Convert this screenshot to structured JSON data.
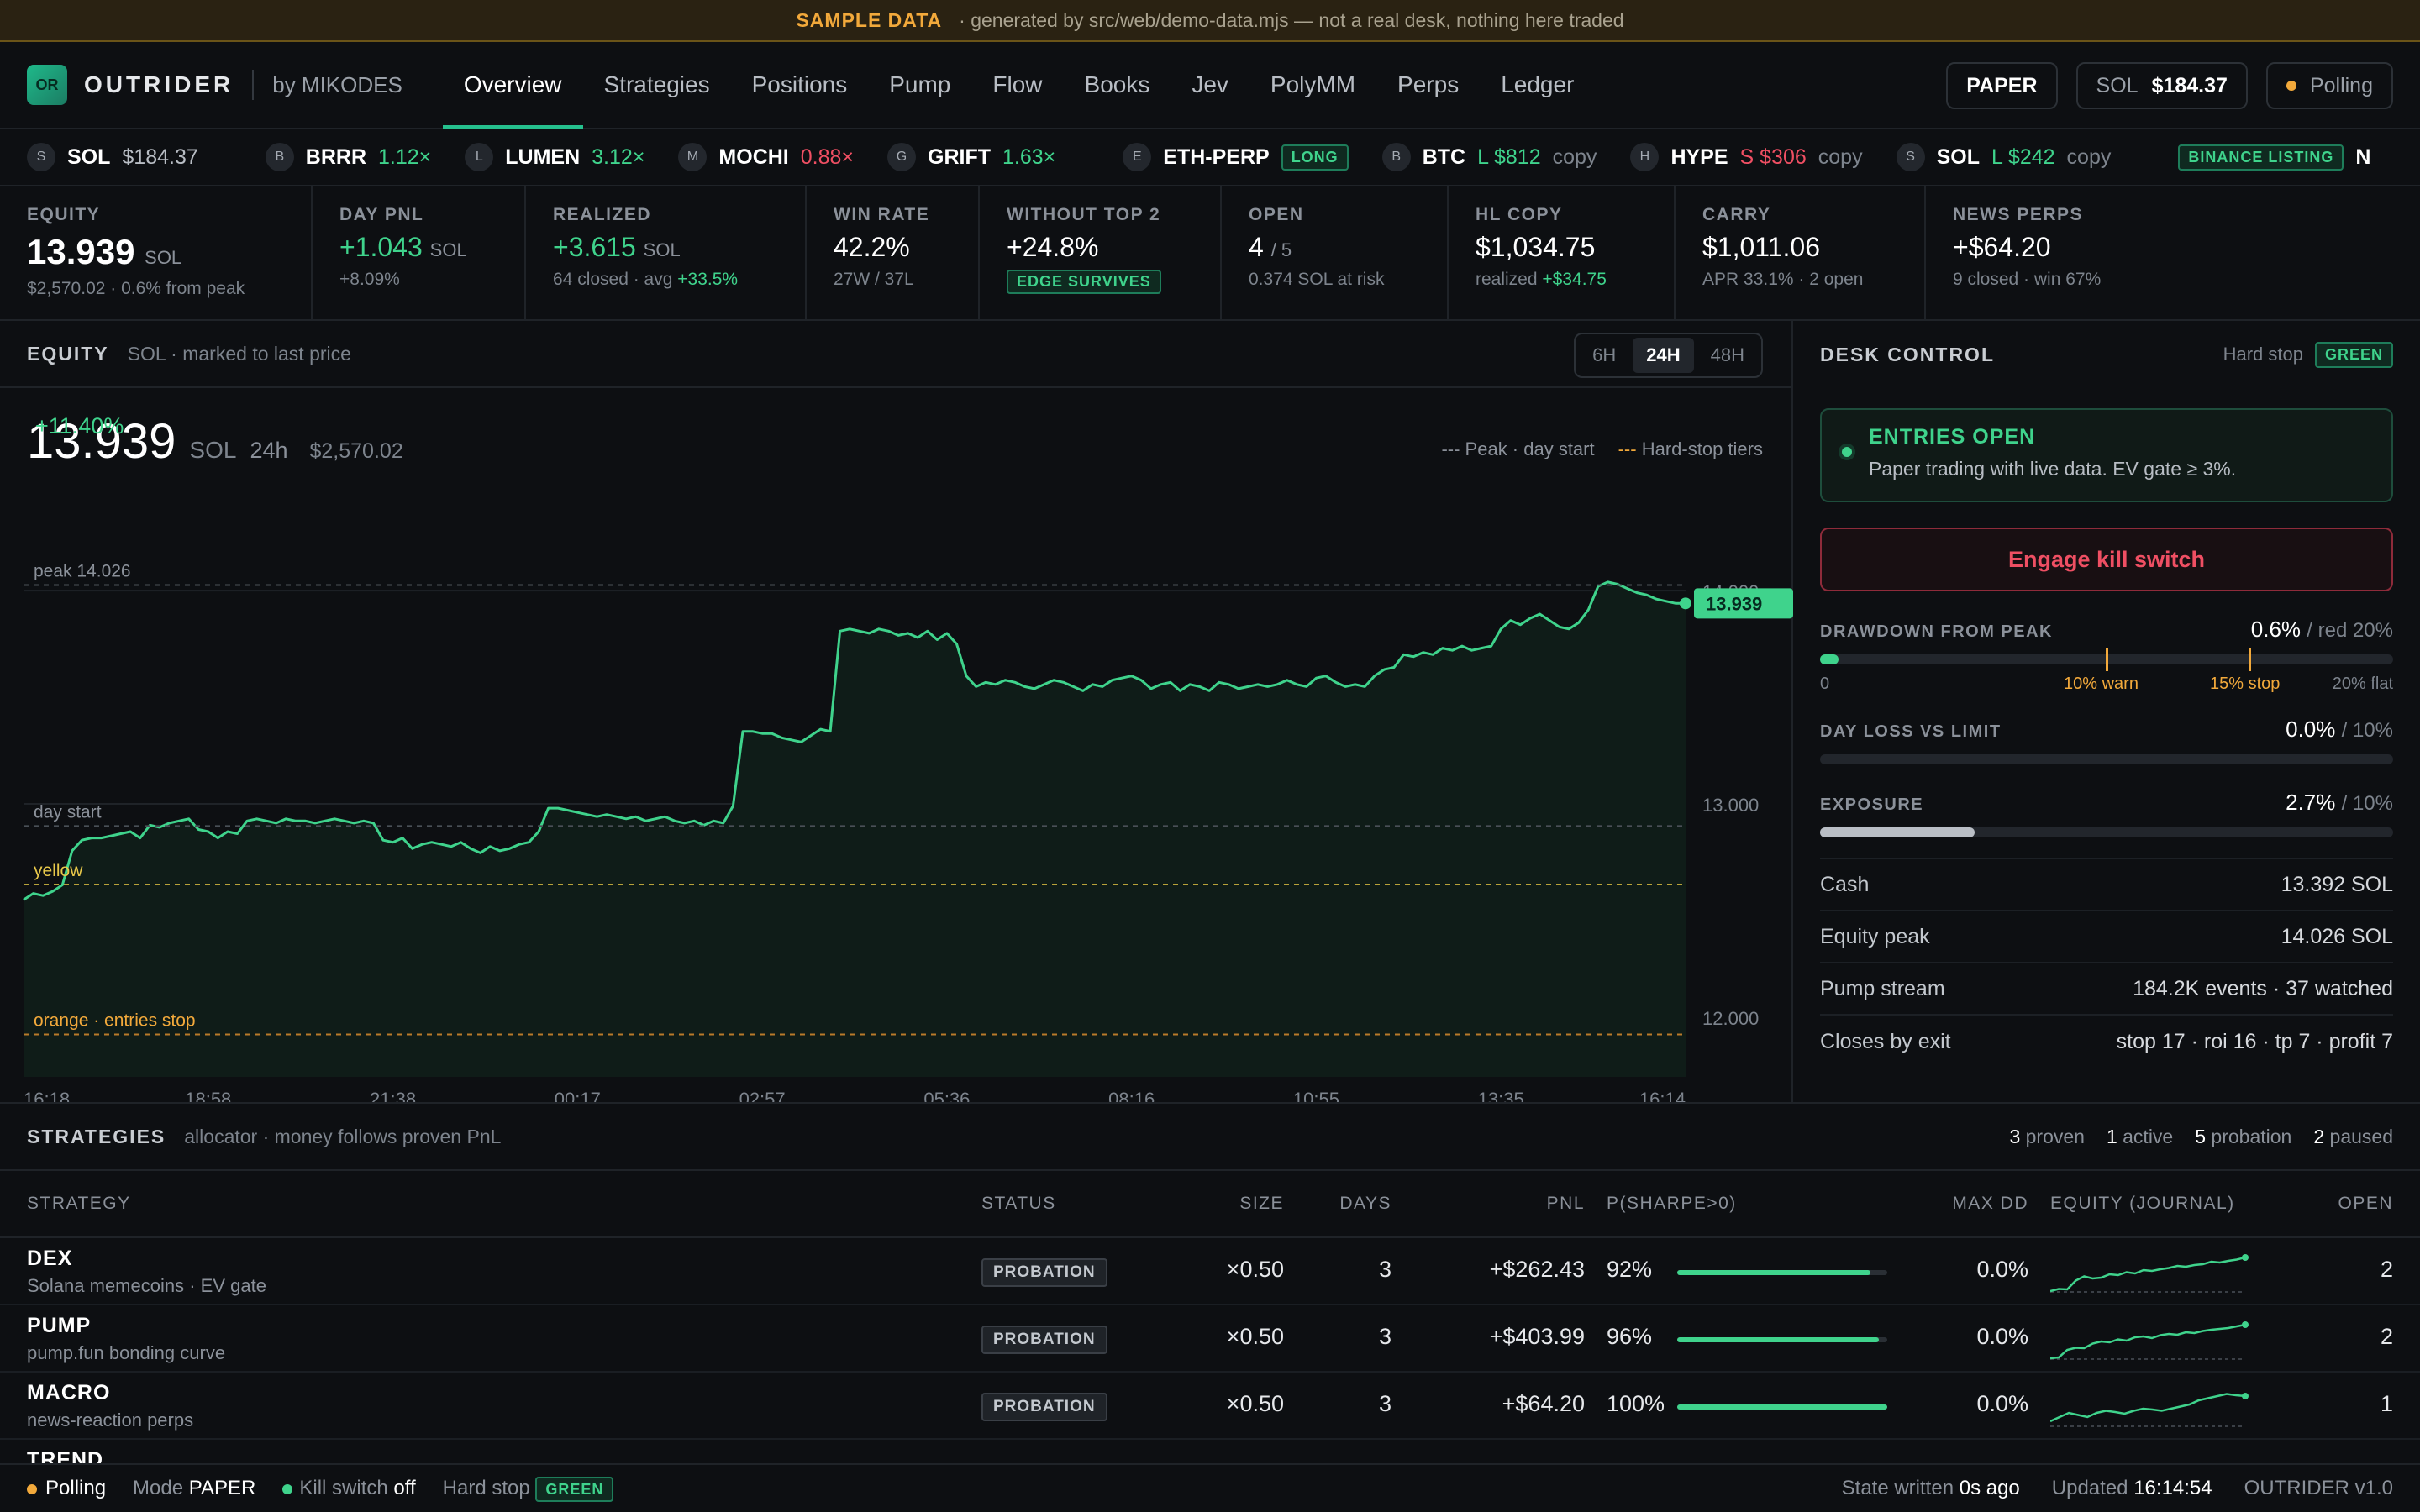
{
  "banner": {
    "title": "SAMPLE DATA",
    "text": "· generated by src/web/demo-data.mjs — not a real desk, nothing here traded"
  },
  "header": {
    "logo": "OR",
    "brand": "OUTRIDER",
    "byline": "by MIKODES",
    "nav": [
      "Overview",
      "Strategies",
      "Positions",
      "Pump",
      "Flow",
      "Books",
      "Jev",
      "PolyMM",
      "Perps",
      "Ledger"
    ],
    "mode": "PAPER",
    "sol_label": "SOL",
    "sol_price": "$184.37",
    "polling": "Polling"
  },
  "ticker": [
    {
      "av": "S",
      "sym": "SOL",
      "val": "$184.37",
      "tone": "dim"
    },
    {
      "av": "B",
      "sym": "BRRR",
      "val": "1.12×",
      "tone": "up"
    },
    {
      "av": "L",
      "sym": "LUMEN",
      "val": "3.12×",
      "tone": "up"
    },
    {
      "av": "M",
      "sym": "MOCHI",
      "val": "0.88×",
      "tone": "dn"
    },
    {
      "av": "G",
      "sym": "GRIFT",
      "val": "1.63×",
      "tone": "up"
    },
    {
      "av": "E",
      "sym": "ETH-PERP",
      "tag": "LONG"
    },
    {
      "av": "B",
      "sym": "BTC",
      "val": "L $812",
      "tone": "up",
      "extra": "copy"
    },
    {
      "av": "H",
      "sym": "HYPE",
      "val": "S $306",
      "tone": "dn",
      "extra": "copy"
    },
    {
      "av": "S",
      "sym": "SOL",
      "val": "L $242",
      "tone": "up",
      "extra": "copy"
    },
    {
      "tag": "BINANCE LISTING",
      "sym": "N"
    }
  ],
  "stats": [
    {
      "label": "EQUITY",
      "value": "13.939",
      "unit": "SOL",
      "note": "$2,570.02 · 0.6% from peak"
    },
    {
      "label": "DAY PNL",
      "value": "+1.043",
      "unit": "SOL",
      "note": "+8.09%"
    },
    {
      "label": "REALIZED",
      "value": "+3.615",
      "unit": "SOL",
      "note_a": "64 closed · avg",
      "note_b": "+33.5%"
    },
    {
      "label": "WIN RATE",
      "value": "42.2%",
      "note": "27W / 37L"
    },
    {
      "label": "WITHOUT TOP 2",
      "value": "+24.8%",
      "tag": "EDGE SURVIVES"
    },
    {
      "label": "OPEN",
      "value": "4",
      "unit": "/ 5",
      "note": "0.374 SOL at risk"
    },
    {
      "label": "HL COPY",
      "value": "$1,034.75",
      "note_a": "realized",
      "note_b": "+$34.75"
    },
    {
      "label": "CARRY",
      "value": "$1,011.06",
      "note": "APR 33.1% · 2 open"
    },
    {
      "label": "NEWS PERPS",
      "value": "+$64.20",
      "note": "9 closed · win 67%"
    }
  ],
  "equity_panel": {
    "title": "EQUITY",
    "subtitle": "SOL · marked to last price",
    "ranges": [
      "6H",
      "24H",
      "48H"
    ],
    "active_range": "24H",
    "value": "13.939",
    "unit": "SOL",
    "change": "+11.40%",
    "window": "24h",
    "usd": "$2,570.02",
    "legend_peak": "--- Peak · day start",
    "legend_stop": "--- Hard-stop tiers"
  },
  "chart_data": {
    "type": "line",
    "ylim": [
      11.72,
      14.28
    ],
    "x_labels": [
      "16:18",
      "18:58",
      "21:38",
      "00:17",
      "02:57",
      "05:36",
      "08:16",
      "10:55",
      "13:35",
      "16:14"
    ],
    "y_ticks": [
      "12.000",
      "13.000",
      "14.000"
    ],
    "y_tick_values": [
      12.0,
      13.0,
      14.0
    ],
    "references": [
      {
        "label": "peak 14.026",
        "value": 14.026,
        "kind": "peak"
      },
      {
        "label": "day start",
        "value": 12.896,
        "kind": "day"
      },
      {
        "label": "yellow",
        "value": 12.622,
        "kind": "yellow"
      },
      {
        "label": "orange · entries stop",
        "value": 11.919,
        "kind": "orange"
      }
    ],
    "last_label": "13.939",
    "values": [
      12.55,
      12.58,
      12.57,
      12.59,
      12.62,
      12.78,
      12.83,
      12.84,
      12.84,
      12.85,
      12.86,
      12.87,
      12.84,
      12.9,
      12.89,
      12.91,
      12.92,
      12.93,
      12.88,
      12.87,
      12.84,
      12.87,
      12.86,
      12.92,
      12.93,
      12.92,
      12.91,
      12.93,
      12.92,
      12.92,
      12.91,
      12.92,
      12.93,
      12.92,
      12.91,
      12.92,
      12.91,
      12.83,
      12.82,
      12.84,
      12.79,
      12.81,
      12.82,
      12.81,
      12.8,
      12.82,
      12.79,
      12.77,
      12.8,
      12.78,
      12.79,
      12.81,
      12.82,
      12.87,
      12.98,
      12.98,
      12.97,
      12.96,
      12.95,
      12.94,
      12.95,
      12.94,
      12.93,
      12.94,
      12.92,
      12.93,
      12.94,
      12.92,
      12.91,
      12.92,
      12.9,
      12.92,
      12.91,
      12.99,
      13.34,
      13.34,
      13.33,
      13.33,
      13.31,
      13.3,
      13.29,
      13.32,
      13.35,
      13.34,
      13.81,
      13.82,
      13.81,
      13.8,
      13.82,
      13.81,
      13.79,
      13.8,
      13.78,
      13.81,
      13.77,
      13.8,
      13.75,
      13.6,
      13.55,
      13.57,
      13.56,
      13.58,
      13.57,
      13.55,
      13.54,
      13.56,
      13.58,
      13.57,
      13.55,
      13.53,
      13.56,
      13.55,
      13.58,
      13.59,
      13.6,
      13.58,
      13.54,
      13.56,
      13.57,
      13.53,
      13.56,
      13.55,
      13.53,
      13.57,
      13.56,
      13.54,
      13.55,
      13.56,
      13.55,
      13.56,
      13.58,
      13.56,
      13.55,
      13.59,
      13.6,
      13.57,
      13.55,
      13.56,
      13.55,
      13.6,
      13.63,
      13.64,
      13.7,
      13.69,
      13.71,
      13.7,
      13.73,
      13.72,
      13.74,
      13.72,
      13.73,
      13.74,
      13.82,
      13.86,
      13.84,
      13.87,
      13.89,
      13.86,
      13.83,
      13.82,
      13.85,
      13.91,
      14.02,
      14.04,
      14.03,
      14.01,
      13.99,
      13.98,
      13.96,
      13.95,
      13.94,
      13.94
    ]
  },
  "desk": {
    "title": "DESK CONTROL",
    "hard_stop_label": "Hard stop",
    "hard_stop_state": "GREEN",
    "entries_title": "ENTRIES OPEN",
    "entries_desc": "Paper trading with live data. EV gate ≥ 3%.",
    "kill_label": "Engage kill switch",
    "drawdown": {
      "label": "DRAWDOWN FROM PEAK",
      "value": "0.6%",
      "limit": "/ red 20%",
      "fraction": 0.006,
      "warn": 0.1,
      "stop": 0.15,
      "ticks": [
        "0",
        "10% warn",
        "15% stop",
        "20% flat"
      ]
    },
    "dayloss": {
      "label": "DAY LOSS VS LIMIT",
      "value": "0.0%",
      "limit": "/ 10%",
      "fraction": 0.0
    },
    "exposure": {
      "label": "EXPOSURE",
      "value": "2.7%",
      "limit": "/ 10%",
      "fraction": 0.27
    },
    "kv": [
      {
        "k": "Cash",
        "v": "13.392 SOL"
      },
      {
        "k": "Equity peak",
        "v": "14.026 SOL"
      },
      {
        "k": "Pump stream",
        "v": "184.2K events · 37 watched"
      },
      {
        "k": "Closes by exit",
        "v": "stop 17 · roi 16 · tp 7 · profit 7"
      }
    ]
  },
  "strategies": {
    "title": "STRATEGIES",
    "subtitle": "allocator · money follows proven PnL",
    "counts": [
      {
        "n": "3",
        "label": "proven"
      },
      {
        "n": "1",
        "label": "active"
      },
      {
        "n": "5",
        "label": "probation"
      },
      {
        "n": "2",
        "label": "paused"
      }
    ],
    "columns": [
      "STRATEGY",
      "STATUS",
      "SIZE",
      "DAYS",
      "PNL",
      "P(SHARPE>0)",
      "MAX DD",
      "EQUITY (JOURNAL)",
      "OPEN"
    ],
    "rows": [
      {
        "name": "DEX",
        "desc": "Solana memecoins · EV gate",
        "status": "PROBATION",
        "size": "×0.50",
        "days": "3",
        "pnl": "+$262.43",
        "psharpe": "92%",
        "p": 0.92,
        "maxdd": "0.0%",
        "open": "2",
        "spark": [
          0.1,
          0.15,
          0.14,
          0.35,
          0.45,
          0.4,
          0.42,
          0.5,
          0.48,
          0.55,
          0.52,
          0.6,
          0.58,
          0.62,
          0.65,
          0.7,
          0.68,
          0.72,
          0.74,
          0.8,
          0.78,
          0.82,
          0.85,
          0.9
        ]
      },
      {
        "name": "PUMP",
        "desc": "pump.fun bonding curve",
        "status": "PROBATION",
        "size": "×0.50",
        "days": "3",
        "pnl": "+$403.99",
        "psharpe": "96%",
        "p": 0.96,
        "maxdd": "0.0%",
        "open": "2",
        "spark": [
          0.1,
          0.12,
          0.3,
          0.35,
          0.34,
          0.45,
          0.5,
          0.48,
          0.55,
          0.52,
          0.6,
          0.62,
          0.58,
          0.65,
          0.68,
          0.66,
          0.72,
          0.7,
          0.75,
          0.78,
          0.8,
          0.82,
          0.86,
          0.9
        ]
      },
      {
        "name": "MACRO",
        "desc": "news-reaction perps",
        "status": "PROBATION",
        "size": "×0.50",
        "days": "3",
        "pnl": "+$64.20",
        "psharpe": "100%",
        "p": 1.0,
        "maxdd": "0.0%",
        "open": "1",
        "spark": [
          0.2,
          0.3,
          0.4,
          0.35,
          0.3,
          0.4,
          0.45,
          0.42,
          0.38,
          0.45,
          0.5,
          0.48,
          0.45,
          0.5,
          0.55,
          0.6,
          0.7,
          0.75,
          0.8,
          0.85,
          0.82,
          0.8
        ]
      },
      {
        "name": "TREND",
        "desc": "",
        "status": "",
        "size": "",
        "days": "",
        "pnl": "",
        "psharpe": "",
        "p": 0,
        "maxdd": "",
        "open": "",
        "spark": []
      }
    ]
  },
  "statusbar": {
    "polling": "Polling",
    "mode_label": "Mode",
    "mode": "PAPER",
    "kill_label": "Kill switch",
    "kill": "off",
    "hard_stop_label": "Hard stop",
    "hard_stop": "GREEN",
    "state_label": "State written",
    "state": "0s ago",
    "updated_label": "Updated",
    "updated": "16:14:54",
    "version": "OUTRIDER v1.0"
  },
  "colors": {
    "accent": "#3fd38c",
    "danger": "#ef4f63",
    "warn": "#f2a93b"
  }
}
